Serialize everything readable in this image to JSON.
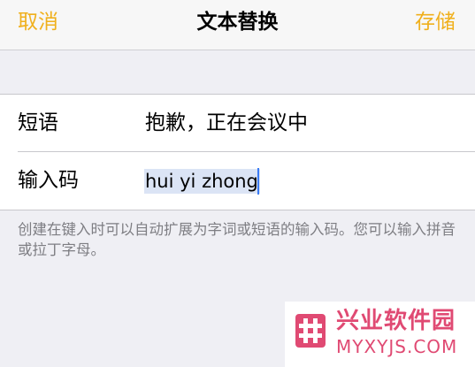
{
  "navbar": {
    "cancel_label": "取消",
    "title": "文本替换",
    "save_label": "存储"
  },
  "form": {
    "phrase_label": "短语",
    "phrase_value": "抱歉，正在会议中",
    "shortcut_label": "输入码",
    "shortcut_value": "hui yi zhong"
  },
  "footnote": "创建在键入时可以自动扩展为字词或短语的输入码。您可以输入拼音或拉丁字母。",
  "watermark": {
    "name": "兴业软件园",
    "domain": "MYXYJS.COM"
  },
  "colors": {
    "accent": "#f0b01d",
    "background": "#efeff4",
    "watermark": "#e04a73"
  }
}
